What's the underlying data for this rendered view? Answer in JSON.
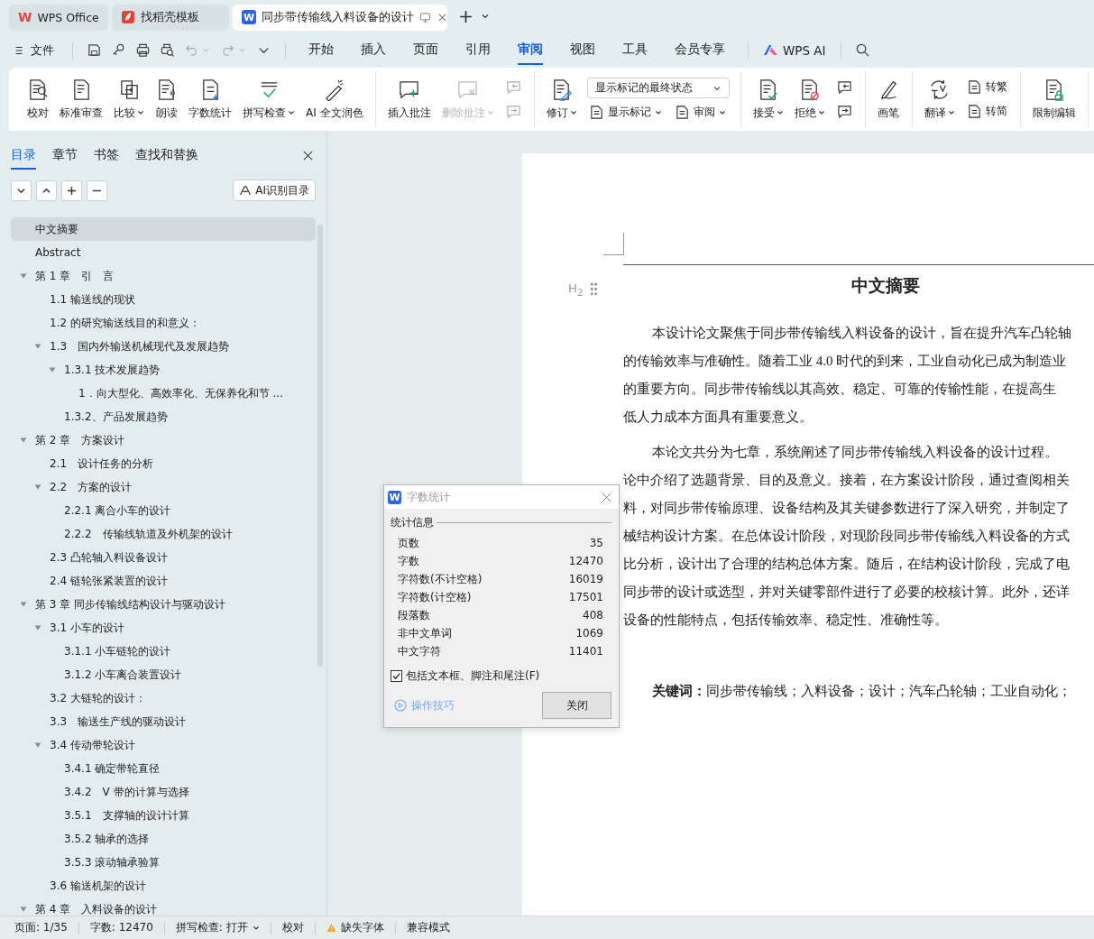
{
  "tabs": [
    {
      "label": "WPS Office",
      "logo": "W",
      "kind": "wps",
      "selected": false
    },
    {
      "label": "找稻壳模板",
      "kind": "docer",
      "selected": false
    },
    {
      "label": "同步带传输线入料设备的设计",
      "logo": "W",
      "kind": "doc",
      "selected": true
    }
  ],
  "menu": {
    "file": "文件",
    "tabs": [
      {
        "label": "开始",
        "selected": false
      },
      {
        "label": "插入",
        "selected": false
      },
      {
        "label": "页面",
        "selected": false
      },
      {
        "label": "引用",
        "selected": false
      },
      {
        "label": "审阅",
        "selected": true
      },
      {
        "label": "视图",
        "selected": false
      },
      {
        "label": "工具",
        "selected": false
      },
      {
        "label": "会员专享",
        "selected": false
      }
    ],
    "ai": "WPS AI"
  },
  "ribbon": [
    {
      "items": [
        {
          "kind": "large",
          "label": "校对",
          "dropdown": false,
          "disabled": false
        },
        {
          "kind": "large",
          "label": "标准审查",
          "dropdown": false,
          "disabled": false
        },
        {
          "kind": "large",
          "label": "比较",
          "dropdown": true,
          "disabled": false
        },
        {
          "kind": "large",
          "label": "朗读",
          "dropdown": false,
          "disabled": false
        },
        {
          "kind": "large",
          "label": "字数统计",
          "dropdown": false,
          "disabled": false
        },
        {
          "kind": "large",
          "label": "拼写检查",
          "dropdown": true,
          "disabled": false
        },
        {
          "kind": "large",
          "label": "AI 全文润色",
          "dropdown": false,
          "disabled": false
        }
      ]
    },
    {
      "items": [
        {
          "kind": "large",
          "label": "插入批注",
          "dropdown": false,
          "disabled": false
        },
        {
          "kind": "large",
          "label": "删除批注",
          "dropdown": true,
          "disabled": true
        },
        {
          "kind": "pair",
          "items": [
            {
              "dropdown": false,
              "disabled": true
            },
            {
              "dropdown": false,
              "disabled": true
            }
          ]
        }
      ]
    },
    {
      "items": [
        {
          "kind": "large",
          "label": "修订",
          "dropdown": true,
          "disabled": false
        },
        {
          "kind": "panel",
          "select": "显示标记的最终状态",
          "items": [
            {
              "label": "显示标记",
              "dropdown": true,
              "disabled": false
            },
            {
              "label": "审阅",
              "dropdown": true,
              "disabled": false
            }
          ]
        }
      ]
    },
    {
      "items": [
        {
          "kind": "large",
          "label": "接受",
          "dropdown": true,
          "disabled": false
        },
        {
          "kind": "large",
          "label": "拒绝",
          "dropdown": true,
          "disabled": false
        },
        {
          "kind": "pair",
          "items": [
            {
              "dropdown": false,
              "disabled": false
            },
            {
              "dropdown": false,
              "disabled": false
            }
          ]
        }
      ]
    },
    {
      "items": [
        {
          "kind": "large",
          "label": "画笔",
          "dropdown": false,
          "disabled": false
        }
      ]
    },
    {
      "items": [
        {
          "kind": "large",
          "label": "翻译",
          "dropdown": true,
          "disabled": false
        },
        {
          "kind": "pair",
          "items": [
            {
              "label": "转繁",
              "dropdown": false,
              "disabled": false
            },
            {
              "label": "转简",
              "dropdown": false,
              "disabled": false
            }
          ]
        }
      ]
    },
    {
      "items": [
        {
          "kind": "large",
          "label": "限制编辑",
          "dropdown": false,
          "disabled": false
        }
      ]
    }
  ],
  "sidebar": {
    "tabs": [
      {
        "label": "目录",
        "selected": true
      },
      {
        "label": "章节",
        "selected": false
      },
      {
        "label": "书签",
        "selected": false
      },
      {
        "label": "查找和替换",
        "selected": false
      }
    ],
    "ai_button": "AI识别目录",
    "toc": [
      {
        "label": "中文摘要",
        "selected": true
      },
      {
        "label": "Abstract",
        "selected": false
      },
      {
        "label": "第 1 章　引　言",
        "selected": false,
        "expanded": true,
        "children": [
          {
            "label": "1.1 输送线的现状",
            "selected": false
          },
          {
            "label": "1.2 的研究输送线目的和意义：",
            "selected": false
          },
          {
            "label": "1.3　国内外输送机械现代及发展趋势",
            "selected": false,
            "expanded": true,
            "children": [
              {
                "label": "1.3.1 技术发展趋势",
                "selected": false,
                "expanded": true,
                "children": [
                  {
                    "label": "1．向大型化、高效率化、无保养化和节 ...",
                    "selected": false
                  }
                ]
              },
              {
                "label": "1.3.2、产品发展趋势",
                "selected": false
              }
            ]
          }
        ]
      },
      {
        "label": "第 2 章　方案设计",
        "selected": false,
        "expanded": true,
        "children": [
          {
            "label": "2.1　设计任务的分析",
            "selected": false
          },
          {
            "label": "2.2　方案的设计",
            "selected": false,
            "expanded": true,
            "children": [
              {
                "label": "2.2.1 离合小车的设计",
                "selected": false
              },
              {
                "label": "2.2.2　传输线轨道及外机架的设计",
                "selected": false
              }
            ]
          },
          {
            "label": "2.3 凸轮轴入料设备设计",
            "selected": false
          },
          {
            "label": "2.4 链轮张紧装置的设计",
            "selected": false
          }
        ]
      },
      {
        "label": "第 3 章  同步传输线结构设计与驱动设计",
        "selected": false,
        "expanded": true,
        "children": [
          {
            "label": "3.1 小车的设计",
            "selected": false,
            "expanded": true,
            "children": [
              {
                "label": "3.1.1 小车链轮的设计",
                "selected": false
              },
              {
                "label": "3.1.2 小车离合装置设计",
                "selected": false
              }
            ]
          },
          {
            "label": "3.2 大链轮的设计：",
            "selected": false
          },
          {
            "label": "3.3　输送生产线的驱动设计",
            "selected": false
          },
          {
            "label": "3.4  传动带轮设计",
            "selected": false,
            "expanded": true,
            "children": [
              {
                "label": "3.4.1 确定带轮直径",
                "selected": false
              },
              {
                "label": "3.4.2　V 带的计算与选择",
                "selected": false
              },
              {
                "label": "3.5.1　支撑轴的设计计算",
                "selected": false
              },
              {
                "label": "3.5.2 轴承的选择",
                "selected": false
              },
              {
                "label": "3.5.3 滚动轴承验算",
                "selected": false
              }
            ]
          },
          {
            "label": "3.6 输送机架的设计",
            "selected": false
          }
        ]
      },
      {
        "label": "第 4 章　入料设备的设计",
        "selected": false,
        "expanded": true
      }
    ]
  },
  "document": {
    "heading_marker": "H$_{2}$",
    "title": "中文摘要",
    "paragraphs": [
      [
        "本设计论文聚焦于同步带传输线入料设备的设计，旨在提升汽车凸轮轴",
        "的传输效率与准确性。随着工业 4.0 时代的到来，工业自动化已成为制造业",
        "的重要方向。同步带传输线以其高效、稳定、可靠的传输性能，在提高生",
        "低人力成本方面具有重要意义。"
      ],
      [
        "本论文共分为七章，系统阐述了同步带传输线入料设备的设计过程。",
        "论中介绍了选题背景、目的及意义。接着，在方案设计阶段，通过查阅相关",
        "料，对同步带传输原理、设备结构及其关键参数进行了深入研究，并制定了",
        "械结构设计方案。在总体设计阶段，对现阶段同步带传输线入料设备的方式",
        "比分析，设计出了合理的结构总体方案。随后，在结构设计阶段，完成了电",
        "同步带的设计或选型，并对关键零部件进行了必要的校核计算。此外，还详",
        "设备的性能特点，包括传输效率、稳定性、准确性等。"
      ]
    ],
    "keywords": "**关键词：**同步带传输线；入料设备；设计；汽车凸轮轴；工业自动化；"
  },
  "dialog": {
    "logo": "W",
    "title": "字数统计",
    "section": "统计信息",
    "rows": [
      {
        "label": "页数",
        "value": "35"
      },
      {
        "label": "字数",
        "value": "12470"
      },
      {
        "label": "字符数(不计空格)",
        "value": "16019"
      },
      {
        "label": "字符数(计空格)",
        "value": "17501"
      },
      {
        "label": "段落数",
        "value": "408"
      },
      {
        "label": "非中文单词",
        "value": "1069"
      },
      {
        "label": "中文字符",
        "value": "11401"
      }
    ],
    "include": {
      "label": "包括文本框、脚注和尾注(F)",
      "checked": true
    },
    "tips": "操作技巧",
    "close": "关闭"
  },
  "status_bar": [
    {
      "kind": "text",
      "text": "页面: 1/35"
    },
    {
      "kind": "text",
      "text": "字数: 12470"
    },
    {
      "kind": "dropdown",
      "text": "拼写检查: 打开"
    },
    {
      "kind": "text",
      "text": "校对"
    },
    {
      "kind": "warning",
      "text": "缺失字体"
    },
    {
      "kind": "text",
      "text": "兼容模式"
    }
  ]
}
